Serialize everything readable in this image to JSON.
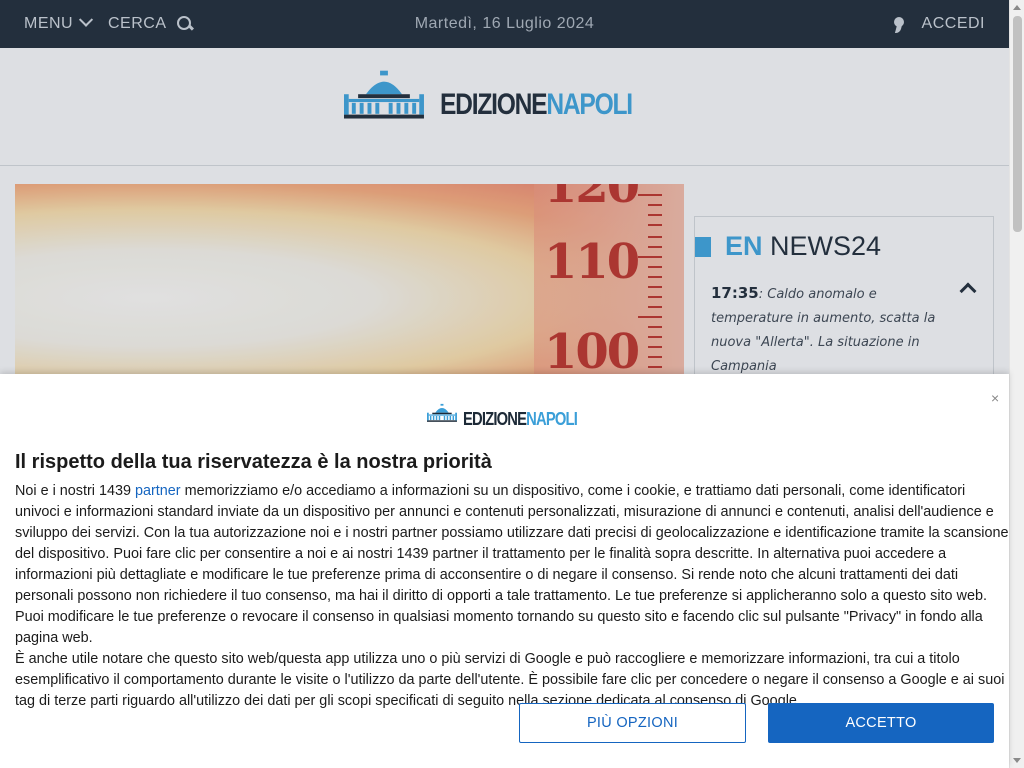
{
  "topbar": {
    "menu_label": "MENU",
    "search_label": "CERCA",
    "date": "Martedì, 16 Luglio 2024",
    "login_label": "ACCEDI"
  },
  "logo": {
    "word_dark": "EDIZIONE",
    "word_blue": "NAPOLI"
  },
  "hero": {
    "numbers": [
      "120",
      "110",
      "100"
    ]
  },
  "news24": {
    "prefix": "EN",
    "title": "NEWS24",
    "time": "17:35",
    "headline": ": Caldo anomalo e temperature in aumento, scatta la nuova \"Allerta\". La situazione in Campania"
  },
  "consent": {
    "close": "×",
    "title": "Il rispetto della tua riservatezza è la nostra priorità",
    "p1_before": "Noi e i nostri 1439 ",
    "p1_link": "partner",
    "p1_after": " memorizziamo e/o accediamo a informazioni su un dispositivo, come i cookie, e trattiamo dati personali, come identificatori univoci e informazioni standard inviate da un dispositivo per annunci e contenuti personalizzati, misurazione di annunci e contenuti, analisi dell'audience e sviluppo dei servizi. Con la tua autorizzazione noi e i nostri partner possiamo utilizzare dati precisi di geolocalizzazione e identificazione tramite la scansione del dispositivo. Puoi fare clic per consentire a noi e ai nostri 1439 partner il trattamento per le finalità sopra descritte. In alternativa puoi accedere a informazioni più dettagliate e modificare le tue preferenze prima di acconsentire o di negare il consenso. Si rende noto che alcuni trattamenti dei dati personali possono non richiedere il tuo consenso, ma hai il diritto di opporti a tale trattamento. Le tue preferenze si applicheranno solo a questo sito web. Puoi modificare le tue preferenze o revocare il consenso in qualsiasi momento tornando su questo sito e facendo clic sul pulsante \"Privacy\" in fondo alla pagina web.",
    "p2": "È anche utile notare che questo sito web/questa app utilizza uno o più servizi di Google e può raccogliere e memorizzare informazioni, tra cui a titolo esemplificativo il comportamento durante le visite o l'utilizzo da parte dell'utente. È possibile fare clic per concedere o negare il consenso a Google e ai suoi tag di terze parti riguardo all'utilizzo dei dati per gli scopi specificati di seguito nella sezione dedicata al consenso di Google.",
    "more_label": "PIÙ OPZIONI",
    "accept_label": "ACCETTO"
  },
  "colors": {
    "topbar_bg": "#1d2a37",
    "brand_blue": "#3b9fd8",
    "button_blue": "#1565c0"
  },
  "icons": {
    "menu": "chevron-down-icon",
    "search": "search-icon",
    "login": "user-icon",
    "news_toggle": "chevron-up-icon",
    "close": "close-icon"
  }
}
